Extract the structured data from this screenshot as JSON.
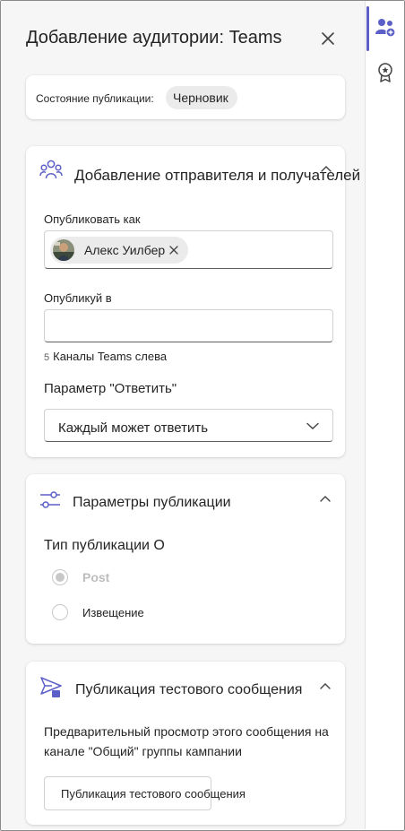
{
  "header": {
    "title": "Добавление аудитории: Teams"
  },
  "status": {
    "label": "Состояние публикации:",
    "value": "Черновик"
  },
  "sender_section": {
    "title": "Добавление отправителя и получателей",
    "publish_as_label": "Опубликовать как",
    "publish_as_person": "Алекс Уилбер",
    "publish_to_label": "Опубликуй в",
    "publish_to_value": "",
    "channels_count": "5",
    "channels_left_label": "Каналы Teams слева",
    "reply_label": "Параметр \"Ответить\"",
    "reply_value": "Каждый может ответить"
  },
  "options_section": {
    "title": "Параметры публикации",
    "type_label": "Тип публикации О",
    "options": [
      {
        "label": "Post",
        "selected": true,
        "disabled": true
      },
      {
        "label": "Извещение",
        "selected": false,
        "disabled": false
      }
    ]
  },
  "test_section": {
    "title": "Публикация тестового сообщения",
    "description": "Предварительный просмотр этого сообщения на канале \"Общий\" группы кампании",
    "button_label": "Публикация тестового сообщения"
  },
  "rail": {
    "items": [
      {
        "icon": "people-add-icon",
        "active": true
      },
      {
        "icon": "ribbon-star-icon",
        "active": false
      }
    ]
  },
  "colors": {
    "accent": "#5b5fc7",
    "panel_bg": "#f6f6f6",
    "card_bg": "#ffffff",
    "disabled_text": "#bdbdbd"
  }
}
